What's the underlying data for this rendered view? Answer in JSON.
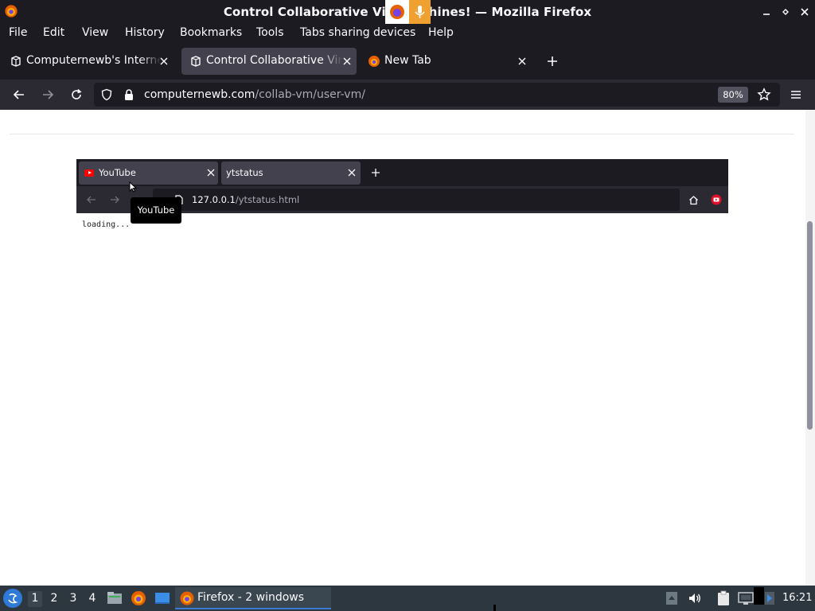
{
  "window": {
    "title": "Control Collaborative Virt  chines! — Mozilla Firefox",
    "icon": "firefox-icon"
  },
  "menu": {
    "items": [
      "File",
      "Edit",
      "View",
      "History",
      "Bookmarks",
      "Tools",
      "Tabs sharing devices",
      "Help"
    ]
  },
  "tabs": [
    {
      "label": "Computernewb's Internet",
      "icon": "computernewb-icon",
      "active": false
    },
    {
      "label": "Control Collaborative Virt",
      "icon": "computernewb-icon",
      "active": true
    },
    {
      "label": "New Tab",
      "icon": "firefox-icon",
      "active": false
    }
  ],
  "nav": {
    "url_domain": "computernewb.com",
    "url_path": "/collab-vm/user-vm/",
    "zoom": "80%"
  },
  "vm": {
    "tabs": [
      {
        "label": "YouTube",
        "icon": "youtube-icon"
      },
      {
        "label": "ytstatus"
      }
    ],
    "url_host": "127.0.0.1",
    "url_path": "/ytstatus.html",
    "tooltip": "YouTube",
    "body_text": "loading..."
  },
  "taskbar": {
    "workspaces": [
      "1",
      "2",
      "3",
      "4"
    ],
    "active_workspace": "1",
    "task_label": "Firefox - 2 windows",
    "clock": "16:21"
  },
  "colors": {
    "chrome_dark": "#1c1b22",
    "toolbar": "#2b2a33",
    "tab_active": "#42414d",
    "taskbar": "#2d3740",
    "accent": "#3b7bd4"
  }
}
